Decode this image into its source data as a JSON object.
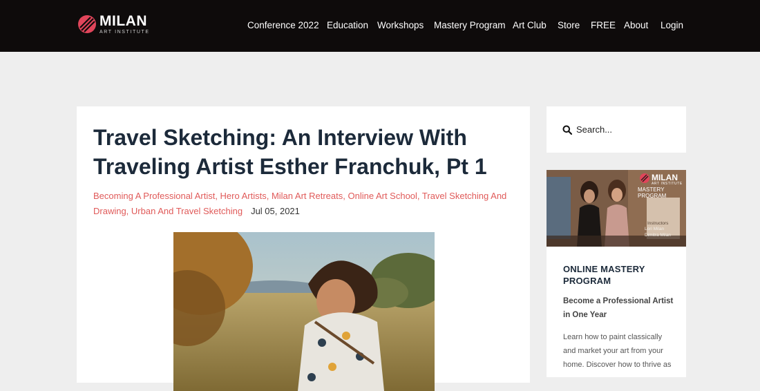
{
  "header": {
    "logo_main": "MILAN",
    "logo_sub": "ART INSTITUTE",
    "nav": [
      "Conference 2022",
      "Education",
      "Workshops",
      "Mastery Program",
      "Art Club",
      "Store",
      "FREE",
      "About",
      "Login"
    ]
  },
  "article": {
    "title": "Travel Sketching: An Interview With Traveling Artist Esther Franchuk, Pt 1",
    "categories": "Becoming A Professional Artist, Hero Artists, Milan Art Retreats, Online Art School, Travel Sketching And Drawing, Urban And Travel Sketching",
    "date": "Jul 05, 2021"
  },
  "sidebar": {
    "search_placeholder": "Search...",
    "promo_logo_main": "MILAN",
    "promo_logo_sub": "ART INSTITUTE",
    "promo_logo_caption": "MASTERY PROGRAM",
    "promo_instructors": [
      "Instructors",
      "Lori Milan",
      "Dimitra Milan"
    ],
    "promo_heading": "ONLINE MASTERY PROGRAM",
    "promo_subheading": "Become a Professional Artist in One Year",
    "promo_body": "Learn how to paint classically and market your art from your home. Discover how to thrive as"
  },
  "colors": {
    "header_bg": "#0e0b0b",
    "accent": "#e05a59",
    "title": "#1c2a3a",
    "page_bg": "#eeeeee"
  }
}
